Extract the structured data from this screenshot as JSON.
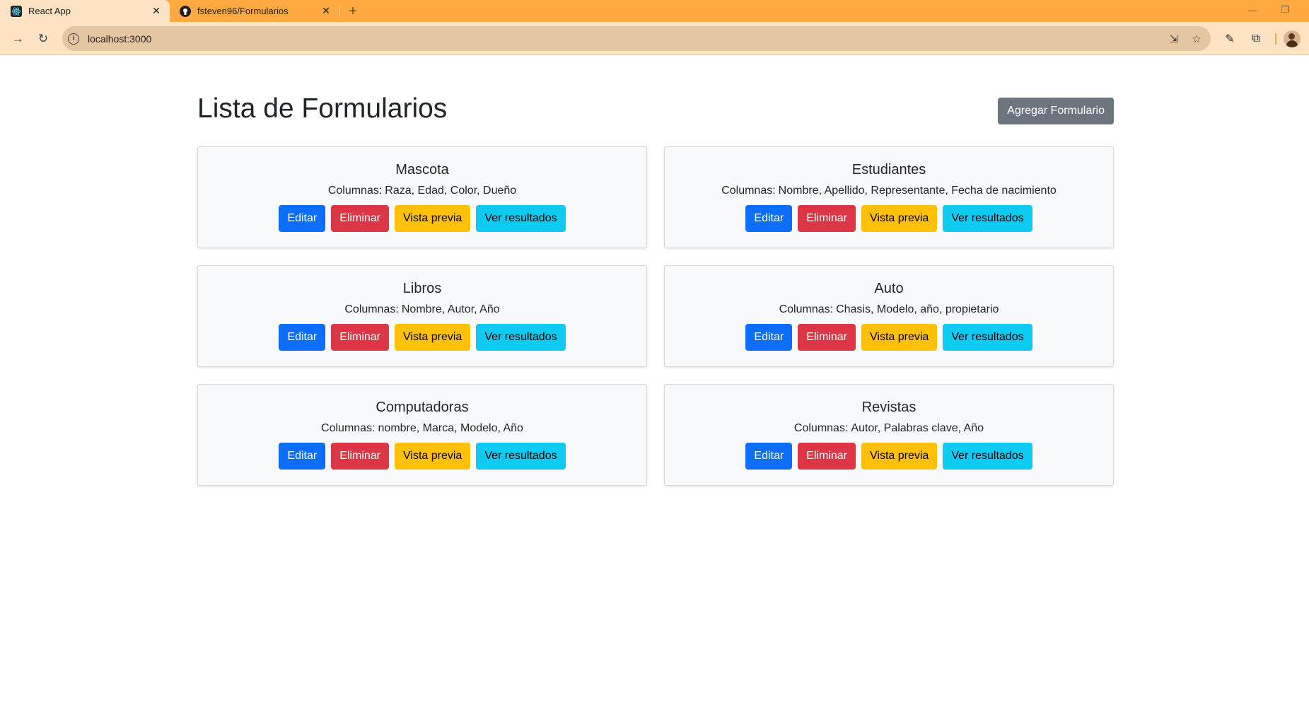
{
  "browser": {
    "tabs": [
      {
        "title": "React App",
        "favicon": "react-icon",
        "active": true
      },
      {
        "title": "fsteven96/Formularios",
        "favicon": "github-icon",
        "active": false
      }
    ],
    "new_tab": "+",
    "url": "localhost:3000"
  },
  "page": {
    "title": "Lista de Formularios",
    "add_button": "Agregar Formulario",
    "columns_label": "Columnas:",
    "actions": {
      "edit": "Editar",
      "delete": "Eliminar",
      "preview": "Vista previa",
      "results": "Ver resultados"
    },
    "forms": [
      {
        "name": "Mascota",
        "columns": "Raza, Edad, Color, Dueño"
      },
      {
        "name": "Estudiantes",
        "columns": "Nombre, Apellido, Representante, Fecha de nacimiento"
      },
      {
        "name": "Libros",
        "columns": "Nombre, Autor, Año"
      },
      {
        "name": "Auto",
        "columns": "Chasis, Modelo, año, propietario"
      },
      {
        "name": "Computadoras",
        "columns": "nombre, Marca, Modelo, Año"
      },
      {
        "name": "Revistas",
        "columns": "Autor, Palabras clave, Año"
      }
    ]
  },
  "colors": {
    "tabstrip": "#ffa940",
    "toolbar": "#fde3c3",
    "primary": "#0d6efd",
    "danger": "#dc3545",
    "warning": "#ffc107",
    "info": "#0dcaf0",
    "secondary": "#6c757d"
  }
}
